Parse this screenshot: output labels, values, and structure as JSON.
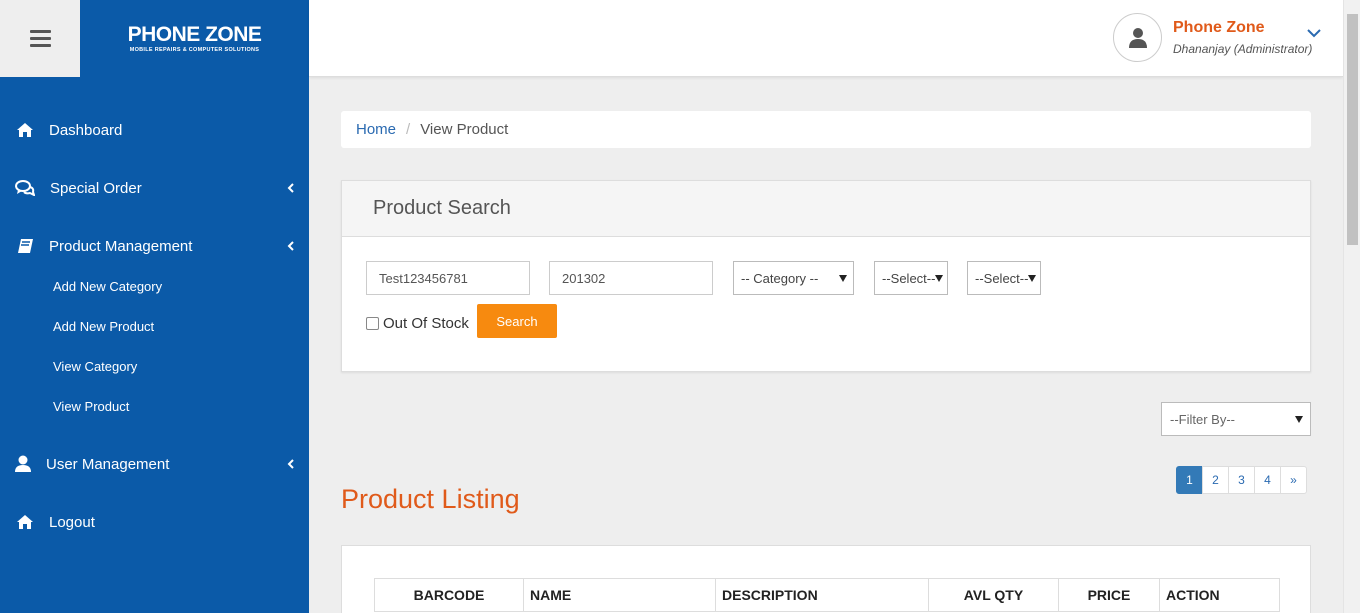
{
  "header": {
    "logo_main": "PHONE ZONE",
    "logo_sub": "MOBILE REPAIRS & COMPUTER SOLUTIONS",
    "user_name": "Phone Zone",
    "user_role": "Dhananjay (Administrator)"
  },
  "sidebar": {
    "items": [
      {
        "label": "Dashboard",
        "icon": "home-icon",
        "has_caret": false
      },
      {
        "label": "Special Order",
        "icon": "comments-icon",
        "has_caret": true
      },
      {
        "label": "Product Management",
        "icon": "book-icon",
        "has_caret": true
      },
      {
        "label": "User Management",
        "icon": "user-icon",
        "has_caret": true
      },
      {
        "label": "Logout",
        "icon": "home-icon",
        "has_caret": false
      }
    ],
    "sub_items": [
      "Add New Category",
      "Add New Product",
      "View Category",
      "View Product"
    ]
  },
  "breadcrumb": {
    "home": "Home",
    "separator": "/",
    "current": "View Product"
  },
  "search_panel": {
    "title": "Product Search",
    "input1_value": "Test123456781",
    "input2_value": "201302",
    "category_select": "-- Category --",
    "select2": "--Select--",
    "select3": "--Select--",
    "out_of_stock_label": "Out Of Stock",
    "out_of_stock_checked": false,
    "search_button": "Search"
  },
  "filter": {
    "selected": "--Filter By--"
  },
  "pagination": {
    "pages": [
      "1",
      "2",
      "3",
      "4",
      "»"
    ],
    "active": "1"
  },
  "listing": {
    "title": "Product Listing",
    "columns": [
      "BARCODE",
      "NAME",
      "DESCRIPTION",
      "AVL QTY",
      "PRICE",
      "ACTION"
    ]
  },
  "colors": {
    "sidebar_bg": "#0b5aa8",
    "accent_orange": "#f78a0f",
    "title_orange": "#e05a1a",
    "link_blue": "#2a6ab1"
  }
}
